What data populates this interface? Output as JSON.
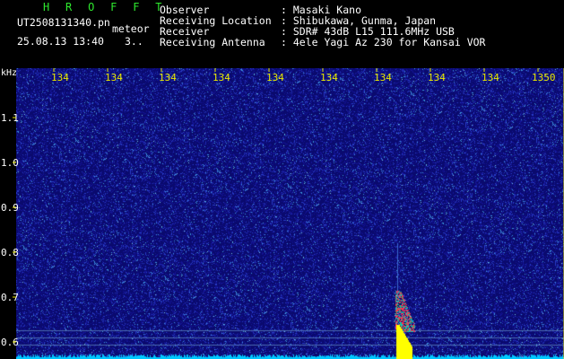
{
  "header": {
    "brand": "H R O F F T",
    "filename": "UT2508131340.pn",
    "tag": "meteor",
    "datetime": "25.08.13 13:40",
    "counter": "3..",
    "labels": [
      "Observer",
      "Receiving Location",
      "Receiver",
      "Receiving Antenna"
    ],
    "values": [
      ": Masaki Kano",
      ": Shibukawa, Gunma, Japan",
      ": SDR# 43dB L15 111.6MHz USB",
      ": 4ele Yagi Az 230 for Kansai VOR"
    ]
  },
  "axis": {
    "unit": "kHz",
    "y_ticks": [
      "1.1",
      "1.0",
      "0.9",
      "0.8",
      "0.7",
      "0.6"
    ],
    "x_ticks": [
      "134",
      "134",
      "134",
      "134",
      "134",
      "134",
      "134",
      "134",
      "134",
      "1350"
    ]
  },
  "colors": {
    "background": "#000000",
    "plot_bg": "#0a0a6e",
    "brand_green": "#2ee82e",
    "text": "#ffffff",
    "tick_yellow": "#e8e800",
    "baseline": "#00c8ff",
    "echo_yellow": "#ffff00",
    "echo_red": "#ff3050",
    "echo_cyan": "#00d0c0"
  }
}
